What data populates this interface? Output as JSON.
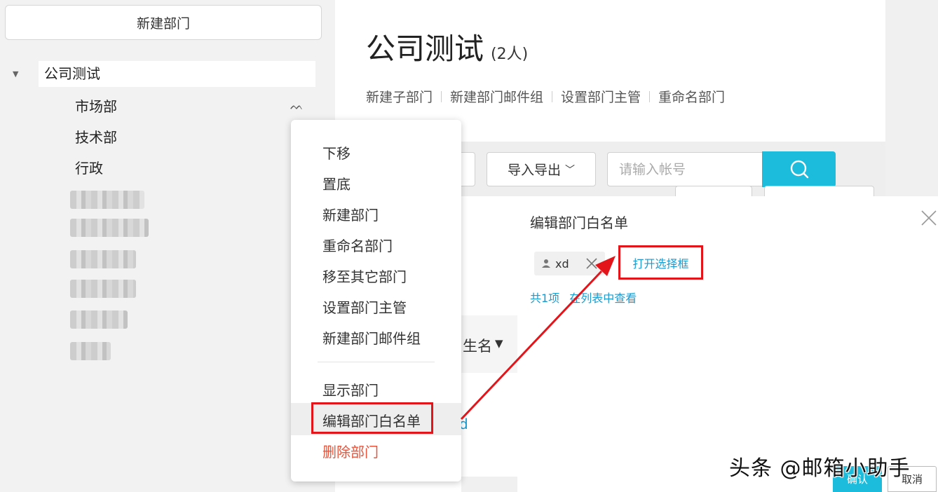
{
  "sidebar": {
    "new_dept_label": "新建部门",
    "root_label": "公司测试",
    "items": [
      "市场部",
      "技术部",
      "行政"
    ]
  },
  "main": {
    "title": "公司测试",
    "count": "(2人)",
    "actions": [
      "新建子部门",
      "新建部门邮件组",
      "设置部门主管",
      "重命名部门"
    ],
    "import_export_label": "导入导出",
    "search_placeholder": "请输入帐号",
    "table_header_partial": "生名"
  },
  "context_menu": {
    "items": [
      "下移",
      "置底",
      "新建部门",
      "重命名部门",
      "移至其它部门",
      "设置部门主管",
      "新建部门邮件组"
    ],
    "items2": [
      "显示部门",
      "编辑部门白名单",
      "删除部门"
    ]
  },
  "dialog": {
    "title": "编辑部门白名单",
    "tag_label": "xd",
    "open_selector": "打开选择框",
    "total": "共1项",
    "view_in_list": "在列表中查看",
    "confirm": "确认",
    "cancel": "取消"
  },
  "watermark": "头条 @邮箱小助手",
  "colors": {
    "accent": "#1bbcdc",
    "link": "#1a9bd0",
    "highlight_red": "#e3151b",
    "danger": "#e8533b"
  }
}
